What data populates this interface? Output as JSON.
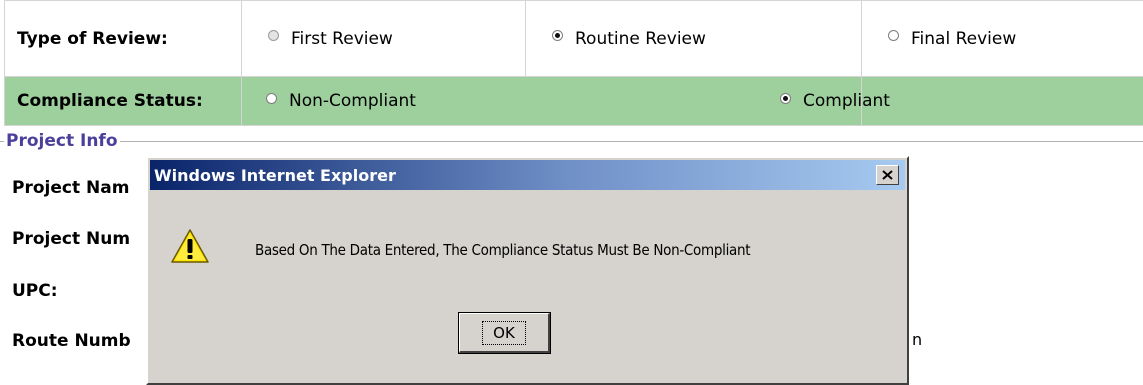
{
  "review": {
    "label": "Type of Review:",
    "options": [
      {
        "label": "First Review",
        "selected": false,
        "disabled": true
      },
      {
        "label": "Routine Review",
        "selected": true,
        "disabled": false
      },
      {
        "label": "Final Review",
        "selected": false,
        "disabled": false
      }
    ]
  },
  "compliance": {
    "label": "Compliance Status:",
    "row_color": "#9ed09e",
    "options": [
      {
        "label": "Non-Compliant",
        "selected": false
      },
      {
        "label": "Compliant",
        "selected": true
      }
    ]
  },
  "project_info": {
    "legend": "Project Info",
    "legend_color": "#4b3f9c",
    "fields": [
      "Project Nam",
      "Project Num",
      "UPC:",
      "Route Numb"
    ],
    "trailing_text": "n"
  },
  "dialog": {
    "title": "Windows Internet Explorer",
    "icon": "warning-icon",
    "message": "Based On The Data Entered, The Compliance Status Must Be Non-Compliant",
    "ok_label": "OK",
    "close_icon": "close-icon"
  }
}
